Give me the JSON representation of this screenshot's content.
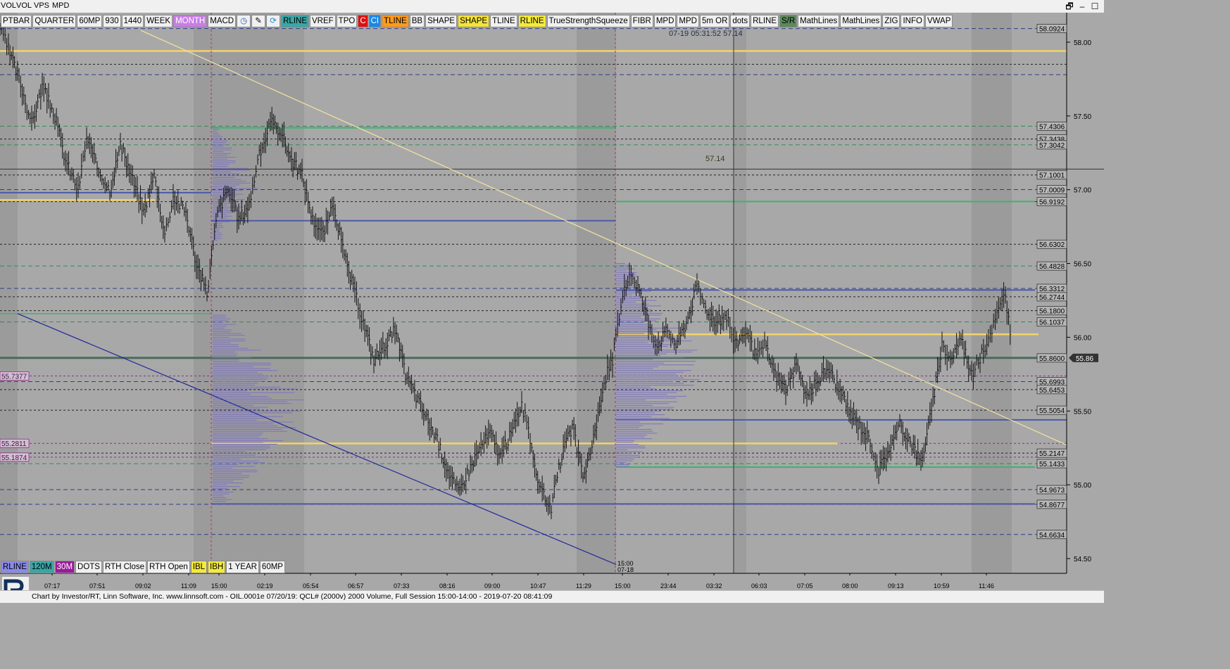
{
  "window": {
    "menu": [
      "VOL",
      "VOL",
      "VPS",
      "MPD"
    ],
    "controls": [
      "🗗",
      "–",
      "☐"
    ]
  },
  "toolbar": [
    {
      "label": "PTBAR",
      "bg": "#f0f0f0",
      "fg": "#000"
    },
    {
      "label": "QUARTER",
      "bg": "#f0f0f0",
      "fg": "#000"
    },
    {
      "label": "60MP",
      "bg": "#f0f0f0",
      "fg": "#000"
    },
    {
      "label": "930",
      "bg": "#f0f0f0",
      "fg": "#000"
    },
    {
      "label": "1440",
      "bg": "#f0f0f0",
      "fg": "#000"
    },
    {
      "label": "WEEK",
      "bg": "#f0f0f0",
      "fg": "#000"
    },
    {
      "label": "MONTH",
      "bg": "#c77fe3",
      "fg": "#fff"
    },
    {
      "label": "MACD",
      "bg": "#f0f0f0",
      "fg": "#000"
    },
    {
      "label": "",
      "icon": "clock-icon",
      "bg": "#f0f0f0",
      "fg": "#1a5fb4"
    },
    {
      "label": "",
      "icon": "pencil-icon",
      "bg": "#f0f0f0",
      "fg": "#000"
    },
    {
      "label": "",
      "icon": "refresh-icon",
      "bg": "#f0f0f0",
      "fg": "#1a88d8"
    },
    {
      "label": "RLINE",
      "bg": "#3aa6a6",
      "fg": "#000"
    },
    {
      "label": "VREF",
      "bg": "#f0f0f0",
      "fg": "#000"
    },
    {
      "label": "TPO",
      "bg": "#f0f0f0",
      "fg": "#000"
    },
    {
      "label": "C",
      "bg": "#e01010",
      "fg": "#fff"
    },
    {
      "label": "CI",
      "bg": "#1a88e8",
      "fg": "#fff"
    },
    {
      "label": "TLINE",
      "bg": "#ff9a1a",
      "fg": "#000"
    },
    {
      "label": "BB",
      "bg": "#f0f0f0",
      "fg": "#000"
    },
    {
      "label": "SHAPE",
      "bg": "#f0f0f0",
      "fg": "#000"
    },
    {
      "label": "SHAPE",
      "bg": "#f5e23a",
      "fg": "#000"
    },
    {
      "label": "TLINE",
      "bg": "#f0f0f0",
      "fg": "#000"
    },
    {
      "label": "RLINE",
      "bg": "#f5ea3a",
      "fg": "#000"
    },
    {
      "label": "TrueStrengthSqueeze",
      "bg": "#f0f0f0",
      "fg": "#000"
    },
    {
      "label": "FIBR",
      "bg": "#f0f0f0",
      "fg": "#000"
    },
    {
      "label": "MPD",
      "bg": "#f0f0f0",
      "fg": "#000"
    },
    {
      "label": "MPD",
      "bg": "#f0f0f0",
      "fg": "#000"
    },
    {
      "label": "5m OR",
      "bg": "#f0f0f0",
      "fg": "#000"
    },
    {
      "label": "dots",
      "bg": "#f0f0f0",
      "fg": "#000"
    },
    {
      "label": "RLINE",
      "bg": "#f0f0f0",
      "fg": "#000"
    },
    {
      "label": "S/R",
      "bg": "#5b8a5b",
      "fg": "#000"
    },
    {
      "label": "MathLines",
      "bg": "#f0f0f0",
      "fg": "#000"
    },
    {
      "label": "MathLines",
      "bg": "#f0f0f0",
      "fg": "#000"
    },
    {
      "label": "ZIG",
      "bg": "#f0f0f0",
      "fg": "#000"
    },
    {
      "label": "INFO",
      "bg": "#f0f0f0",
      "fg": "#000"
    },
    {
      "label": "VWAP",
      "bg": "#f0f0f0",
      "fg": "#000"
    }
  ],
  "bottom_toolbar": [
    {
      "label": "RLINE",
      "bg": "#8a8ae8",
      "fg": "#000"
    },
    {
      "label": "120M",
      "bg": "#3aa6a6",
      "fg": "#000"
    },
    {
      "label": "30M",
      "bg": "#9a1a9a",
      "fg": "#fff"
    },
    {
      "label": "DOTS",
      "bg": "#f0f0f0",
      "fg": "#000"
    },
    {
      "label": "RTH Close",
      "bg": "#f0f0f0",
      "fg": "#000"
    },
    {
      "label": "RTH Open",
      "bg": "#f0f0f0",
      "fg": "#000"
    },
    {
      "label": "IBL",
      "bg": "#f5ea3a",
      "fg": "#000"
    },
    {
      "label": "IBH",
      "bg": "#f5ea3a",
      "fg": "#000"
    },
    {
      "label": "1 YEAR",
      "bg": "#f0f0f0",
      "fg": "#000"
    },
    {
      "label": "60MP",
      "bg": "#f0f0f0",
      "fg": "#000"
    }
  ],
  "footer_text": "Chart by Investor/RT, Linn Software, Inc. www.linnsoft.com - OIL.0001e    07/20/19: QCL# (2000v) 2000 Volume, Full Session 15:00-14:00 - 2019-07-20 08:41:09",
  "chart_data": {
    "type": "candlestick-volume-profile",
    "symbol": "QCL#",
    "ylim": [
      54.4,
      58.2
    ],
    "y_ticks": [
      "58.00",
      "57.50",
      "57.00",
      "56.50",
      "56.00",
      "55.50",
      "55.00",
      "54.50"
    ],
    "x_ticks": [
      "07:17",
      "07:51",
      "09:02",
      "11:09",
      "15:00",
      "02:19",
      "05:54",
      "06:57",
      "07:33",
      "08:16",
      "09:00",
      "10:47",
      "11:29",
      "15:00",
      "23:44",
      "03:32",
      "06:03",
      "07:05",
      "08:00",
      "09:13",
      "10:59",
      "11:46"
    ],
    "session_marker_label": "15:00\n07-18",
    "crosshair_readout": "07-19 05:31:52  57.14",
    "crosshair_value": "57.14",
    "last_price": "55.86",
    "price_level_labels_right": [
      "58.0924",
      "57.4306",
      "57.3438",
      "57.3042",
      "57.1001",
      "57.0009",
      "56.9192",
      "56.6302",
      "56.4828",
      "56.3312",
      "56.2744",
      "56.1800",
      "56.1037",
      "55.8600",
      "55.6993",
      "55.6453",
      "55.5054",
      "55.2147",
      "55.1433",
      "54.9673",
      "54.8677",
      "54.6634"
    ],
    "price_level_labels_left": [
      "55.7377",
      "55.2811",
      "55.1874"
    ],
    "price_path": [
      [
        0,
        58.1
      ],
      [
        0.4,
        57.95
      ],
      [
        0.9,
        57.75
      ],
      [
        1.5,
        57.45
      ],
      [
        2.0,
        57.7
      ],
      [
        2.6,
        57.5
      ],
      [
        3.1,
        57.2
      ],
      [
        3.7,
        57.0
      ],
      [
        4.1,
        57.35
      ],
      [
        4.6,
        57.15
      ],
      [
        5.2,
        57.0
      ],
      [
        5.7,
        57.3
      ],
      [
        6.2,
        57.1
      ],
      [
        6.8,
        56.85
      ],
      [
        7.3,
        57.1
      ],
      [
        7.8,
        56.7
      ],
      [
        8.2,
        56.95
      ],
      [
        8.8,
        56.85
      ],
      [
        9.3,
        56.5
      ],
      [
        9.8,
        56.3
      ],
      [
        10.3,
        56.85
      ],
      [
        10.8,
        57.0
      ],
      [
        11.3,
        56.8
      ],
      [
        11.8,
        56.9
      ],
      [
        12.2,
        57.2
      ],
      [
        12.8,
        57.45
      ],
      [
        13.3,
        57.4
      ],
      [
        13.8,
        57.2
      ],
      [
        14.3,
        57.1
      ],
      [
        14.8,
        56.8
      ],
      [
        15.3,
        56.7
      ],
      [
        15.8,
        56.9
      ],
      [
        16.3,
        56.55
      ],
      [
        16.8,
        56.3
      ],
      [
        17.2,
        56.1
      ],
      [
        17.7,
        55.85
      ],
      [
        18.2,
        55.95
      ],
      [
        18.7,
        56.05
      ],
      [
        19.2,
        55.75
      ],
      [
        19.7,
        55.6
      ],
      [
        20.2,
        55.45
      ],
      [
        20.7,
        55.3
      ],
      [
        21.2,
        55.1
      ],
      [
        21.7,
        54.95
      ],
      [
        22.2,
        55.1
      ],
      [
        22.7,
        55.25
      ],
      [
        23.2,
        55.35
      ],
      [
        23.7,
        55.2
      ],
      [
        24.2,
        55.35
      ],
      [
        24.7,
        55.55
      ],
      [
        25.1,
        55.3
      ],
      [
        25.6,
        54.95
      ],
      [
        26.1,
        54.85
      ],
      [
        26.6,
        55.2
      ],
      [
        27.1,
        55.4
      ],
      [
        27.6,
        55.05
      ],
      [
        28.1,
        55.3
      ],
      [
        28.6,
        55.7
      ],
      [
        29.0,
        55.85
      ],
      [
        29.4,
        56.2
      ],
      [
        29.8,
        56.45
      ],
      [
        30.2,
        56.35
      ],
      [
        30.7,
        56.1
      ],
      [
        31.1,
        55.95
      ],
      [
        31.6,
        56.05
      ],
      [
        32.0,
        55.95
      ],
      [
        32.5,
        56.1
      ],
      [
        33.0,
        56.35
      ],
      [
        33.4,
        56.2
      ],
      [
        33.9,
        56.1
      ],
      [
        34.4,
        56.15
      ],
      [
        34.8,
        55.95
      ],
      [
        35.3,
        56.05
      ],
      [
        35.8,
        55.85
      ],
      [
        36.2,
        55.95
      ],
      [
        36.7,
        55.75
      ],
      [
        37.2,
        55.65
      ],
      [
        37.7,
        55.8
      ],
      [
        38.2,
        55.6
      ],
      [
        38.7,
        55.7
      ],
      [
        39.2,
        55.8
      ],
      [
        39.7,
        55.65
      ],
      [
        40.2,
        55.5
      ],
      [
        40.7,
        55.4
      ],
      [
        41.2,
        55.3
      ],
      [
        41.6,
        55.1
      ],
      [
        42.1,
        55.25
      ],
      [
        42.6,
        55.4
      ],
      [
        43.1,
        55.3
      ],
      [
        43.6,
        55.15
      ],
      [
        44.1,
        55.5
      ],
      [
        44.6,
        55.95
      ],
      [
        45.0,
        55.85
      ],
      [
        45.5,
        56.0
      ],
      [
        46.0,
        55.75
      ],
      [
        46.4,
        55.85
      ],
      [
        46.8,
        56.0
      ],
      [
        47.2,
        56.15
      ],
      [
        47.6,
        56.3
      ],
      [
        47.9,
        55.9
      ]
    ]
  }
}
